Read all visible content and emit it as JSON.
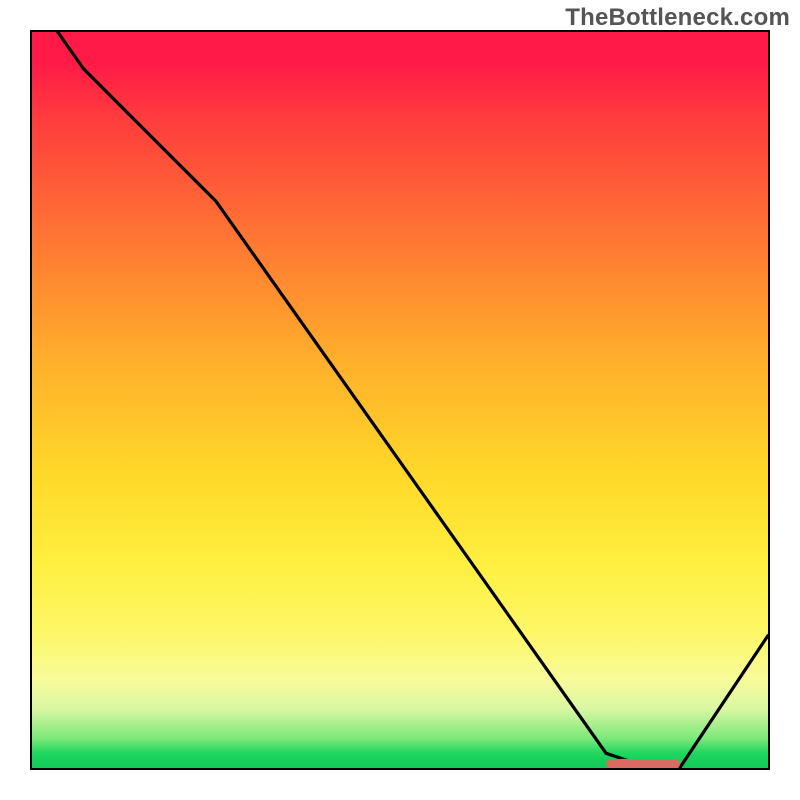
{
  "watermark": "TheBottleneck.com",
  "accent_colors": {
    "marker": "#d96b63",
    "curve": "#000000"
  },
  "chart_data": {
    "type": "line",
    "title": "",
    "xlabel": "",
    "ylabel": "",
    "xlim": [
      0,
      100
    ],
    "ylim": [
      0,
      100
    ],
    "x": [
      0,
      7,
      25,
      78,
      84,
      88,
      100
    ],
    "values": [
      105,
      95,
      77,
      2,
      0,
      0,
      18
    ],
    "flat_region": {
      "x_start": 78,
      "x_end": 88,
      "y": 0.5
    },
    "notes": "Axes have no tick labels or titles in the source image; values are estimated from pixel positions relative to the framed plot area."
  }
}
